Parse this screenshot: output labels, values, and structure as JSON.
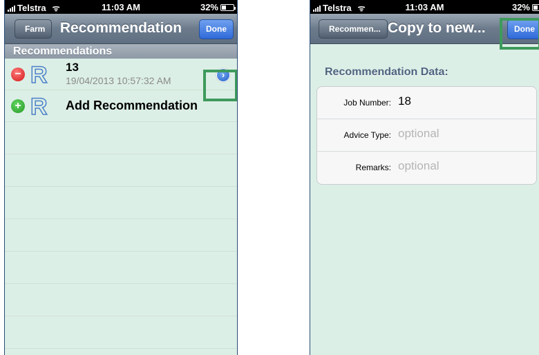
{
  "left": {
    "status": {
      "carrier": "Telstra",
      "time": "11:03 AM",
      "battery": "32%"
    },
    "nav": {
      "back": "Farm",
      "title": "Recommendation",
      "done": "Done"
    },
    "section_header": "Recommendations",
    "items": [
      {
        "title": "13",
        "subtitle": "19/04/2013 10:57:32 AM"
      }
    ],
    "add_label": "Add Recommendation",
    "icon_letter": "R",
    "disclosure_glyph": "›"
  },
  "right": {
    "status": {
      "carrier": "Telstra",
      "time": "11:03 AM",
      "battery": "32%"
    },
    "nav": {
      "back": "Recommen...",
      "title": "Copy to new...",
      "done": "Done"
    },
    "group_title": "Recommendation Data:",
    "fields": [
      {
        "label": "Job Number:",
        "value": "18",
        "placeholder": false
      },
      {
        "label": "Advice Type:",
        "value": "optional",
        "placeholder": true
      },
      {
        "label": "Remarks:",
        "value": "optional",
        "placeholder": true
      }
    ]
  },
  "colors": {
    "highlight": "#3e9a5c",
    "done_button": "#2f6ad9",
    "background": "#dcefe6"
  }
}
